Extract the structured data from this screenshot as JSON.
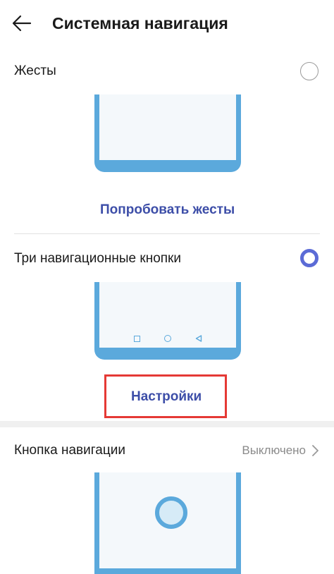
{
  "header": {
    "title": "Системная навигация"
  },
  "gestures": {
    "label": "Жесты",
    "try_link": "Попробовать жесты"
  },
  "three_buttons": {
    "label": "Три навигационные кнопки",
    "settings_link": "Настройки"
  },
  "nav_button": {
    "label": "Кнопка навигации",
    "status": "Выключено"
  },
  "colors": {
    "accent": "#5b6bd6",
    "link": "#3d4ea8",
    "phone_frame": "#5ba9dc",
    "highlight": "#e53935"
  }
}
